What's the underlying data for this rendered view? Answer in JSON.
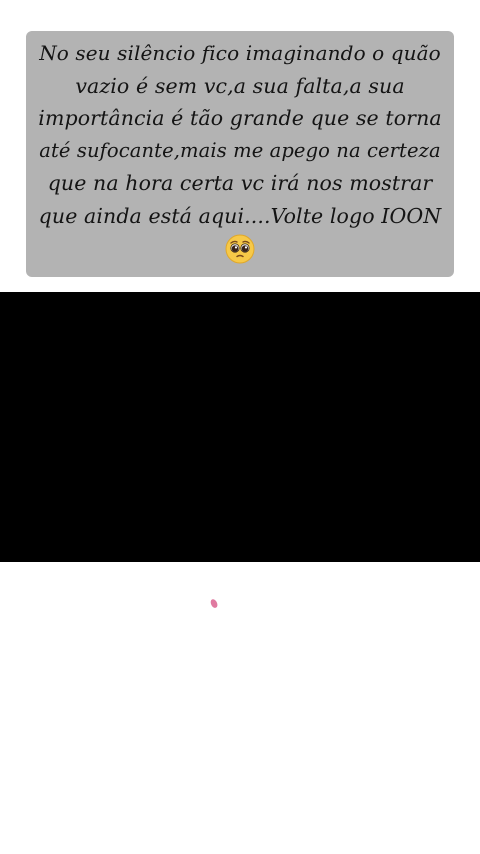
{
  "caption": {
    "lines": [
      "No seu silêncio fico imaginando o quão",
      "vazio é sem vc,a sua falta,a sua",
      "importância é tão grande que se torna",
      "até sufocante,mais me apego na certeza",
      "que na hora certa vc irá nos mostrar",
      "que ainda está aqui....Volte logo IOON"
    ],
    "emoji": "pleading-face-icon"
  },
  "colors": {
    "caption_background": "#b3b3b3",
    "caption_text": "#141414",
    "panel": "#000000",
    "page": "#ffffff",
    "pink_mark": "#e07aa0"
  }
}
